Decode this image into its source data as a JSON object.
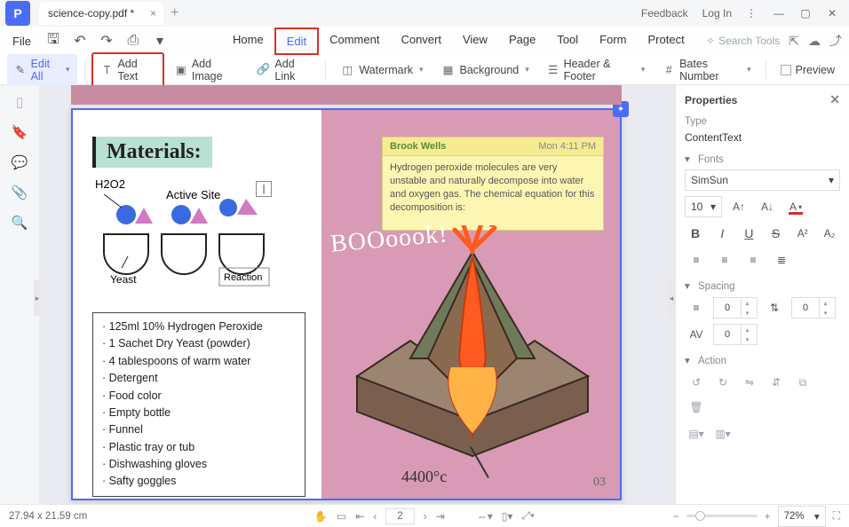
{
  "tab": {
    "title": "science-copy.pdf *"
  },
  "titlebar": {
    "feedback": "Feedback",
    "login": "Log In"
  },
  "menu": {
    "file": "File"
  },
  "tabs": [
    "Home",
    "Edit",
    "Comment",
    "Convert",
    "View",
    "Page",
    "Tool",
    "Form",
    "Protect"
  ],
  "search_placeholder": "Search Tools",
  "toolbar": {
    "edit_all": "Edit All",
    "add_text": "Add Text",
    "add_image": "Add Image",
    "add_link": "Add Link",
    "watermark": "Watermark",
    "background": "Background",
    "header_footer": "Header & Footer",
    "bates": "Bates Number",
    "preview": "Preview"
  },
  "note": {
    "author": "Brook Wells",
    "time": "Mon 4:11 PM",
    "text": "Hydrogen peroxide molecules are very unstable and naturally decompose into water and oxygen gas. The chemical equation for this decomposition is:"
  },
  "page": {
    "materials_heading": "Materials:",
    "h2o2_label": "H2O2",
    "active_site_label": "Active Site",
    "yeast_label": "Yeast",
    "reaction_label": "Reaction",
    "boom": "BOOoook!",
    "temp": "4400°c",
    "number": "03",
    "materials": [
      "125ml 10% Hydrogen Peroxide",
      "1 Sachet Dry Yeast (powder)",
      "4 tablespoons of warm water",
      "Detergent",
      "Food color",
      "Empty bottle",
      "Funnel",
      "Plastic tray or tub",
      "Dishwashing gloves",
      "Safty goggles"
    ]
  },
  "props": {
    "title": "Properties",
    "type_label": "Type",
    "type_value": "ContentText",
    "fonts_label": "Fonts",
    "font_family": "SimSun",
    "font_size": "10",
    "spacing_label": "Spacing",
    "line_spacing": "0",
    "para_spacing": "0",
    "char_spacing": "0",
    "action_label": "Action"
  },
  "status": {
    "dims": "27.94 x 21.59 cm",
    "page_current": "2",
    "zoom": "72%"
  }
}
